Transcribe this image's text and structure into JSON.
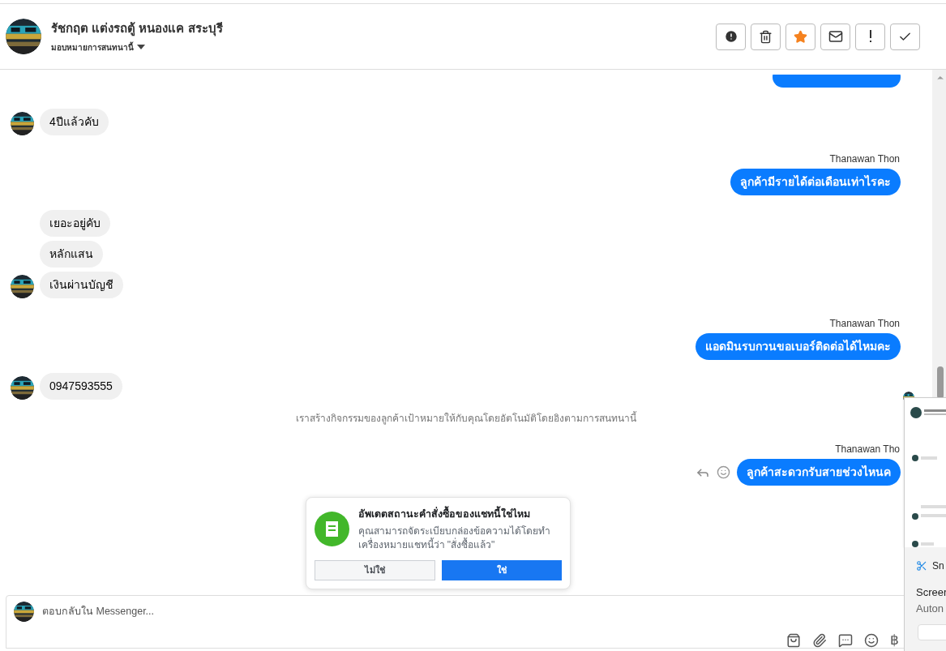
{
  "header": {
    "name": "รัชกฤต แต่งรถตู้ หนองแค สระบุรี",
    "assign_label": "มอบหมายการสนทนานี้",
    "actions": [
      {
        "kind": "alert"
      },
      {
        "kind": "trash"
      },
      {
        "kind": "star"
      },
      {
        "kind": "mail"
      },
      {
        "kind": "bang"
      },
      {
        "kind": "check"
      }
    ]
  },
  "messages": [
    {
      "kind": "outgoing_clipped"
    },
    {
      "kind": "incoming",
      "texts": [
        "4ปีแล้วคับ"
      ]
    },
    {
      "kind": "outgoing",
      "sender": "Thanawan Thon",
      "text": "ลูกค้ามีรายได้ต่อเดือนเท่าไรคะ"
    },
    {
      "kind": "incoming",
      "texts": [
        "เยอะอยู่คับ",
        "หลักแสน",
        "เงินผ่านบัญชี"
      ]
    },
    {
      "kind": "outgoing",
      "sender": "Thanawan Thon",
      "text": "แอดมินรบกวนขอเบอร์ติดต่อได้ไหมคะ"
    },
    {
      "kind": "incoming",
      "texts": [
        "0947593555"
      ],
      "seen": true
    },
    {
      "kind": "system",
      "text": "เราสร้างกิจกรรมของลูกค้าเป้าหมายให้กับคุณโดยอัตโนมัติโดยอิงตามการสนทนานี้"
    },
    {
      "kind": "outgoing",
      "sender": "Thanawan Tho",
      "text": "ลูกค้าสะดวกรับสายช่วงไหนค",
      "actions": true
    }
  ],
  "prompt": {
    "title": "อัพเดตสถานะคำสั่งซื้อของแชทนี้ใช่ไหม",
    "body": "คุณสามารถจัดระเบียบกล่องข้อความได้โดยทำเครื่องหมายแชทนี้ว่า \"สั่งซื้อแล้ว\"",
    "buttons": [
      {
        "label": "ไม่ใช่",
        "kind": "secondary"
      },
      {
        "label": "ใช่",
        "kind": "primary"
      }
    ]
  },
  "composer": {
    "placeholder": "ตอบกลับใน Messenger...",
    "tools": [
      {
        "kind": "bag"
      },
      {
        "kind": "clip"
      },
      {
        "kind": "chat"
      },
      {
        "kind": "smile"
      },
      {
        "kind": "text",
        "text": "฿"
      }
    ]
  },
  "notification": {
    "app": "Sn",
    "title": "Screer",
    "body": "Auton"
  }
}
